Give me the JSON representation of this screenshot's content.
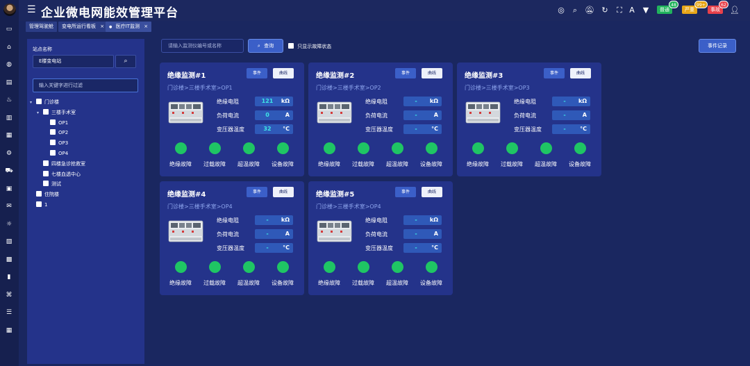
{
  "app": {
    "title": "企业微电网能效管理平台"
  },
  "rail": {
    "icons": [
      "monitor-icon",
      "home-icon",
      "globe-icon",
      "chart-icon",
      "alarm-icon",
      "bar-chart-icon",
      "line-chart-icon",
      "tool-icon",
      "bus-icon",
      "building-icon",
      "message-icon",
      "bulb-icon",
      "report-icon",
      "grid-icon",
      "battery-icon",
      "fan-icon",
      "list-icon",
      "calendar-icon"
    ]
  },
  "header": {
    "alarms": [
      {
        "label": "普通",
        "count": "48",
        "color": "#21b35c"
      },
      {
        "label": "严重",
        "count": "99+",
        "color": "#e8a618"
      },
      {
        "label": "事故",
        "count": "62",
        "color": "#e8404a"
      }
    ]
  },
  "tabs": [
    {
      "label": "管理驾驶舱",
      "closable": false,
      "active": false
    },
    {
      "label": "变电所运行看板",
      "closable": true,
      "active": false
    },
    {
      "label": "医疗IT监测",
      "closable": true,
      "active": true
    }
  ],
  "tab_close_glyph": "×",
  "tab_dot_glyph": "●",
  "sidebar": {
    "site_label": "站点名称",
    "site_value": "E楼变电站",
    "filter_placeholder": "输入关键字进行过滤",
    "tree": [
      {
        "label": "门诊楼",
        "level": 0,
        "expanded": true
      },
      {
        "label": "三楼手术室",
        "level": 1,
        "expanded": true
      },
      {
        "label": "OP1",
        "level": 2
      },
      {
        "label": "OP2",
        "level": 2
      },
      {
        "label": "OP3",
        "level": 2
      },
      {
        "label": "OP4",
        "level": 2
      },
      {
        "label": "四楼急诊抢救室",
        "level": 1
      },
      {
        "label": "七楼血透中心",
        "level": 1
      },
      {
        "label": "测试",
        "level": 1
      },
      {
        "label": "住院楼",
        "level": 0
      },
      {
        "label": "1",
        "level": 0
      }
    ]
  },
  "toolbar": {
    "search_placeholder": "请输入监测仪编号或名称",
    "query_label": "查询",
    "fault_only_label": "只显示故障状态",
    "event_log_label": "事件记录"
  },
  "card_common": {
    "event_label": "事件",
    "curve_label": "曲线",
    "metric_labels": [
      "绝缘电阻",
      "负荷电流",
      "变压器温度"
    ],
    "metric_units": [
      "kΩ",
      "A",
      "°C"
    ],
    "fault_labels": [
      "绝缘故障",
      "过载故障",
      "超温故障",
      "设备故障"
    ]
  },
  "cards": [
    {
      "title": "绝缘监测#1",
      "path": "门诊楼>三楼手术室>OP1",
      "values": [
        "121",
        "0",
        "32"
      ],
      "faults": [
        "normal",
        "normal",
        "normal",
        "normal"
      ]
    },
    {
      "title": "绝缘监测#2",
      "path": "门诊楼>三楼手术室>OP2",
      "values": [
        "-",
        "-",
        "-"
      ],
      "faults": [
        "normal",
        "normal",
        "normal",
        "normal"
      ]
    },
    {
      "title": "绝缘监测#3",
      "path": "门诊楼>三楼手术室>OP3",
      "values": [
        "-",
        "-",
        "-"
      ],
      "faults": [
        "normal",
        "normal",
        "normal",
        "normal"
      ]
    },
    {
      "title": "绝缘监测#4",
      "path": "门诊楼>三楼手术室>OP4",
      "values": [
        "-",
        "-",
        "-"
      ],
      "faults": [
        "normal",
        "normal",
        "normal",
        "normal"
      ]
    },
    {
      "title": "绝缘监测#5",
      "path": "门诊楼>三楼手术室>OP4",
      "values": [
        "-",
        "-",
        "-"
      ],
      "faults": [
        "normal",
        "normal",
        "normal",
        "normal"
      ]
    }
  ],
  "colors": {
    "status_normal": "#1fc564",
    "value_text": "#3ee6e6"
  }
}
